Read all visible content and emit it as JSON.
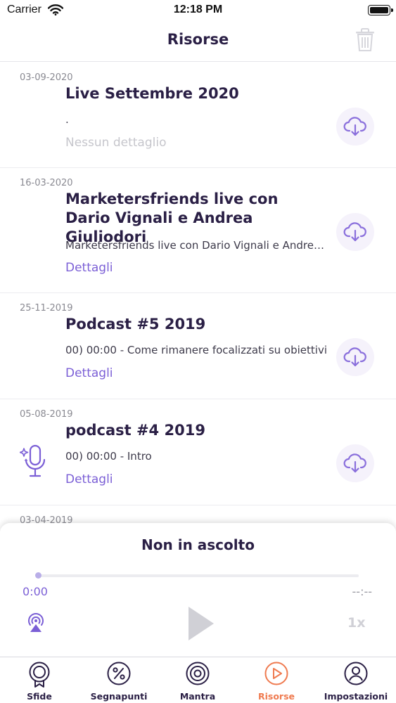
{
  "status_bar": {
    "carrier": "Carrier",
    "time": "12:18 PM"
  },
  "nav": {
    "title": "Risorse",
    "trash_icon": "trash-icon"
  },
  "resources": [
    {
      "date": "03-09-2020",
      "title": "Live Settembre 2020",
      "description": ".",
      "link": "Nessun dettaglio",
      "link_enabled": false,
      "icon": "cloud-download-icon"
    },
    {
      "date": "16-03-2020",
      "title": "Marketersfriends live con Dario Vignali e Andrea Giuliodori",
      "description": "Marketersfriends live con Dario Vignali e Andrea Giuliodori",
      "link": "Dettagli",
      "link_enabled": true,
      "icon": "cloud-download-icon"
    },
    {
      "date": "25-11-2019",
      "title": "Podcast #5 2019",
      "description": "00) 00:00 - Come rimanere focalizzati su obiettivi",
      "link": "Dettagli",
      "link_enabled": true,
      "icon": "cloud-download-icon"
    },
    {
      "date": "05-08-2019",
      "title": "podcast #4 2019",
      "description": "00) 00:00 - Intro",
      "link": "Dettagli",
      "link_enabled": true,
      "icon": "cloud-download-icon",
      "thumb_icon": "microphone-sparkle-icon"
    },
    {
      "date": "03-04-2019"
    }
  ],
  "player": {
    "title": "Non in ascolto",
    "elapsed": "0:00",
    "remaining": "--:--",
    "progress": 0,
    "speed": "1x",
    "airplay_icon": "airplay-icon",
    "play_icon": "play-icon"
  },
  "tabs": [
    {
      "label": "Sfide",
      "icon": "badge-icon",
      "active": false
    },
    {
      "label": "Segnapunti",
      "icon": "percent-icon",
      "active": false
    },
    {
      "label": "Mantra",
      "icon": "target-icon",
      "active": false
    },
    {
      "label": "Risorse",
      "icon": "play-circle-icon",
      "active": true
    },
    {
      "label": "Impostazioni",
      "icon": "user-icon",
      "active": false
    }
  ],
  "colors": {
    "accent": "#7b5fd6",
    "tab_active": "#ef7a4f",
    "text_dark": "#2a1f45"
  }
}
